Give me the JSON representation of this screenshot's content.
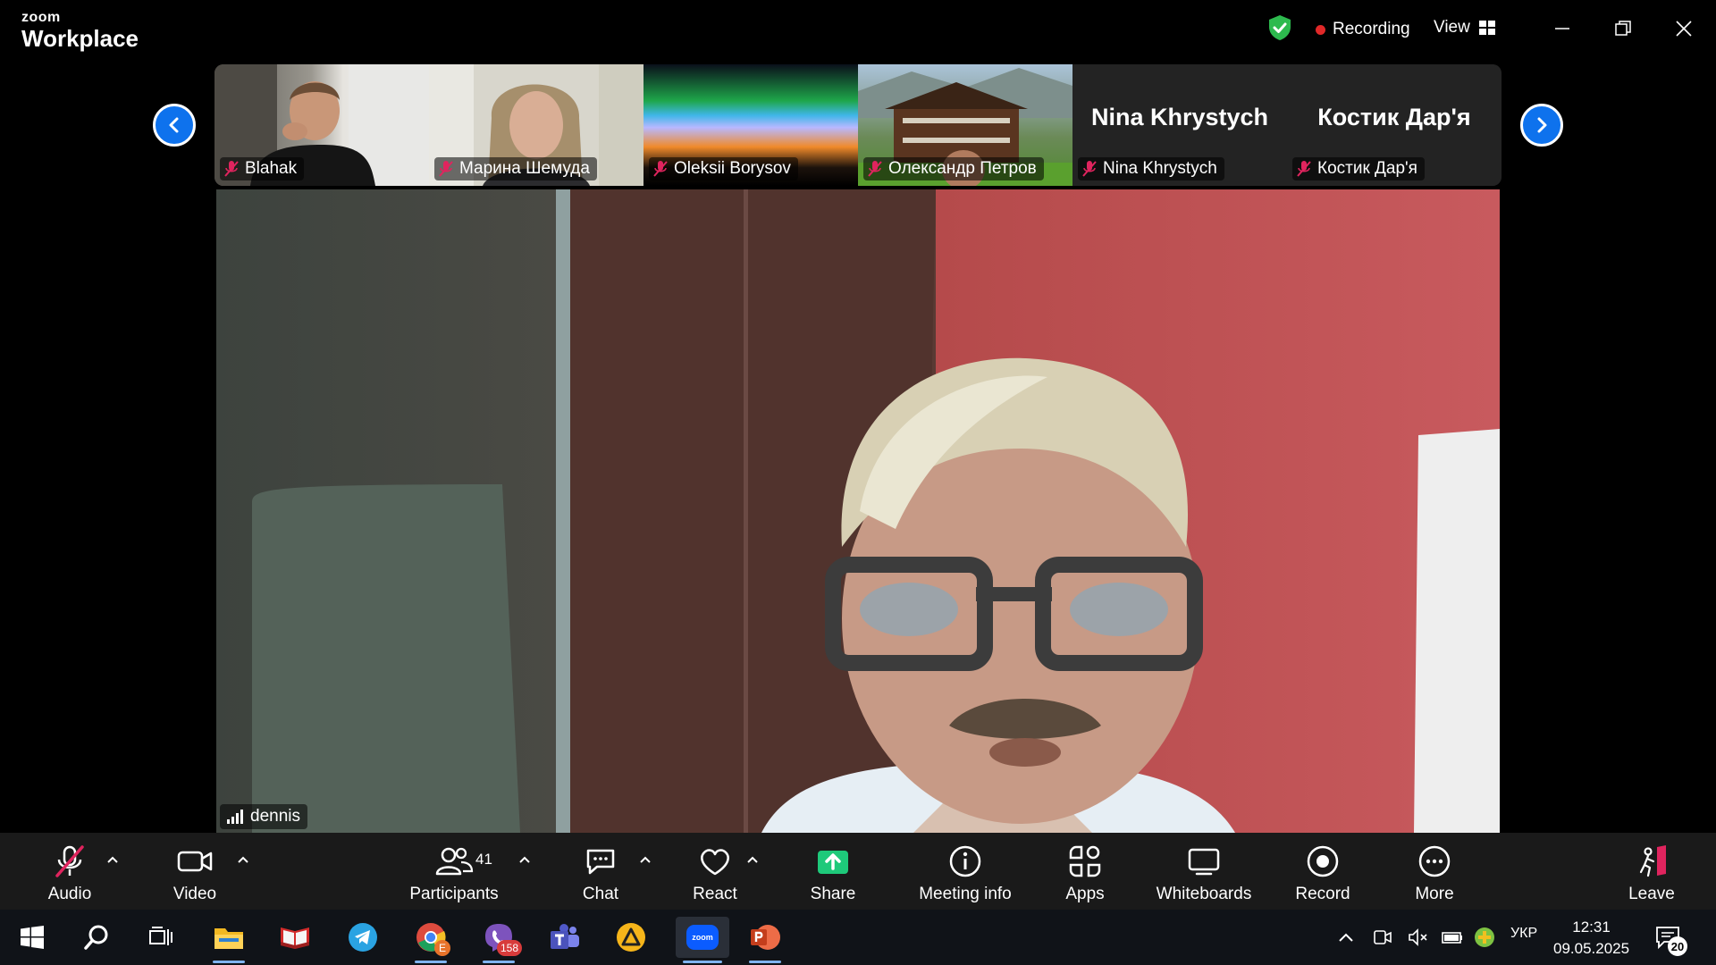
{
  "window": {
    "brand_small": "zoom",
    "brand_big": "Workplace",
    "recording_label": "Recording",
    "view_label": "View"
  },
  "thumbnails": [
    {
      "name": "Blahak",
      "muted": true,
      "display": "video"
    },
    {
      "name": "Марина Шемуда",
      "muted": true,
      "display": "video"
    },
    {
      "name": "Oleksii Borysov",
      "muted": true,
      "display": "video"
    },
    {
      "name": "Олександр Петров",
      "muted": true,
      "display": "video"
    },
    {
      "name": "Nina Khrystych",
      "muted": true,
      "display": "name",
      "big_name": "Nina Khrystych"
    },
    {
      "name": "Костик Дар'я",
      "muted": true,
      "display": "name",
      "big_name": "Костик Дар'я"
    }
  ],
  "main_speaker": {
    "name": "dennis"
  },
  "toolbar": {
    "audio": "Audio",
    "video": "Video",
    "participants": "Participants",
    "participant_count": "41",
    "chat": "Chat",
    "react": "React",
    "share": "Share",
    "meeting_info": "Meeting info",
    "apps": "Apps",
    "whiteboards": "Whiteboards",
    "record": "Record",
    "more": "More",
    "leave": "Leave"
  },
  "taskbar": {
    "viber_badge": "158",
    "chrome_badge": "E",
    "zoom_label": "zoom",
    "language": "УКР",
    "time": "12:31",
    "date": "09.05.2025",
    "notifications": "20"
  },
  "colors": {
    "accent_blue": "#0e72ed",
    "share_green": "#1ec97a",
    "muted_red": "#e0245e",
    "recording_red": "#e02828",
    "shield_green": "#2dba4e"
  }
}
